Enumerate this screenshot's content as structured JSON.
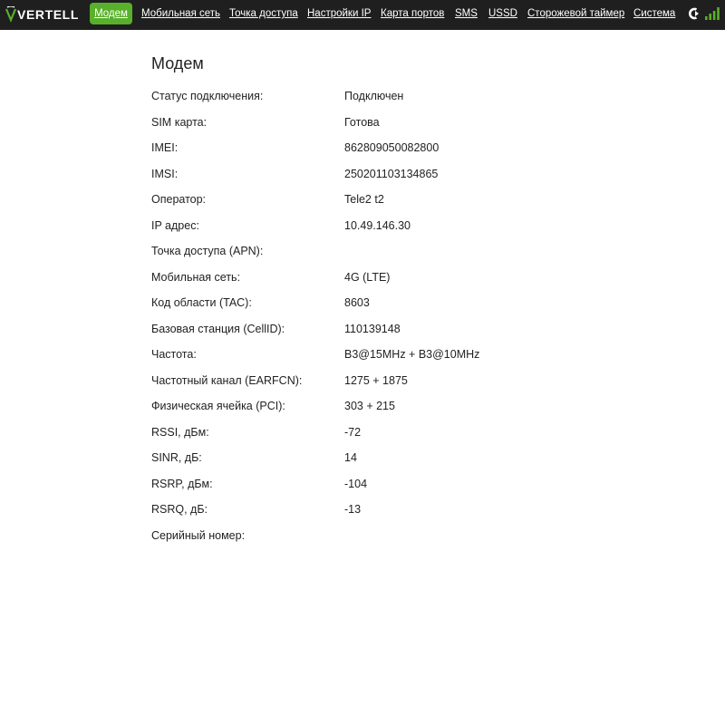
{
  "header": {
    "logo_text": "VERTELL",
    "colors": {
      "bar": "#1f1f1f",
      "active": "#58b02b",
      "signal": "#58b02b"
    },
    "nav": [
      {
        "label": "Модем",
        "active": true
      },
      {
        "label": "Мобильная сеть"
      },
      {
        "label": "Точка доступа"
      },
      {
        "label": "Настройки IP"
      },
      {
        "label": "Карта портов"
      },
      {
        "label": "SMS"
      },
      {
        "label": "USSD"
      },
      {
        "label": "Сторожевой таймер"
      },
      {
        "label": "Система"
      }
    ],
    "status_icons": [
      "network-type-icon",
      "signal-strength-icon"
    ],
    "signal_bars_active": 4,
    "signal_bars_total": 4
  },
  "main": {
    "title": "Модем",
    "rows": [
      {
        "label": "Статус подключения:",
        "value": "Подключен"
      },
      {
        "label": "SIM карта:",
        "value": "Готова"
      },
      {
        "label": "IMEI:",
        "value": "862809050082800"
      },
      {
        "label": "IMSI:",
        "value": "250201103134865"
      },
      {
        "label": "Оператор:",
        "value": "Tele2 t2"
      },
      {
        "label": "IP адрес:",
        "value": "10.49.146.30"
      },
      {
        "label": "Точка доступа (APN):",
        "value": ""
      },
      {
        "label": "Мобильная сеть:",
        "value": "4G (LTE)"
      },
      {
        "label": "Код области (TAC):",
        "value": "8603"
      },
      {
        "label": "Базовая станция (CellID):",
        "value": "110139148"
      },
      {
        "label": "Частота:",
        "value": "B3@15MHz + B3@10MHz"
      },
      {
        "label": "Частотный канал (EARFCN):",
        "value": "1275 + 1875"
      },
      {
        "label": "Физическая ячейка (PCI):",
        "value": "303 + 215"
      },
      {
        "label": "RSSI, дБм:",
        "value": "-72"
      },
      {
        "label": "SINR, дБ:",
        "value": "14"
      },
      {
        "label": "RSRP, дБм:",
        "value": "-104"
      },
      {
        "label": "RSRQ, дБ:",
        "value": "-13"
      },
      {
        "label": "Серийный номер:",
        "value": ""
      }
    ]
  }
}
